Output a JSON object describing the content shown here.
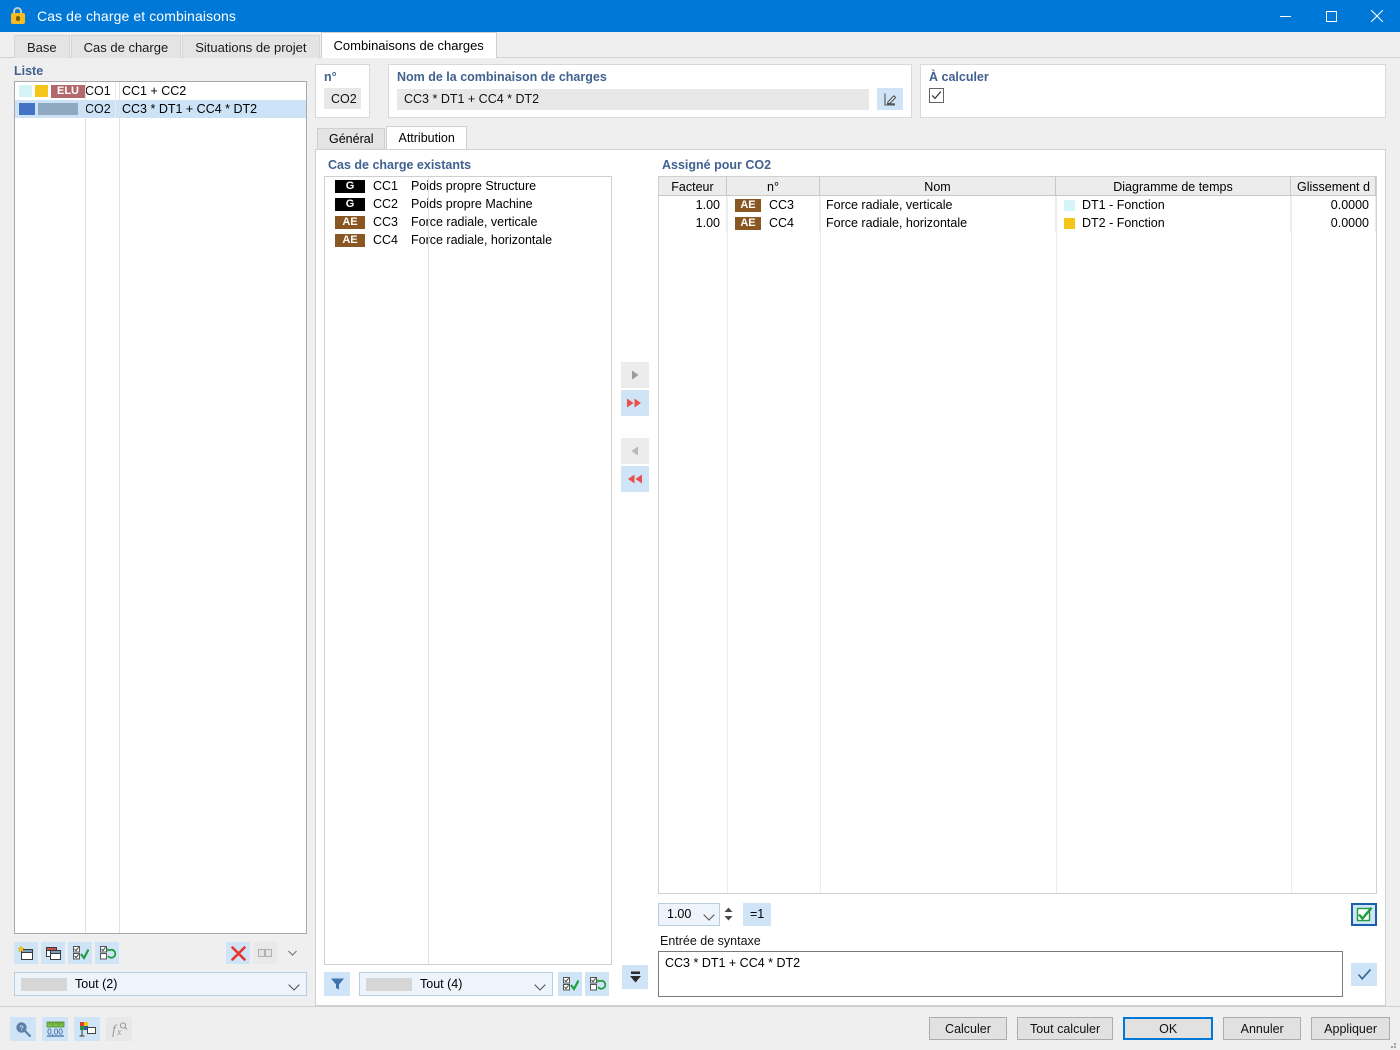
{
  "window": {
    "title": "Cas de charge et combinaisons",
    "icon": "load-case-icon",
    "controls": {
      "minimize": "minimize-icon",
      "maximize": "maximize-icon",
      "close": "close-icon"
    }
  },
  "tabs": [
    {
      "label": "Base",
      "active": false
    },
    {
      "label": "Cas de charge",
      "active": false
    },
    {
      "label": "Situations de projet",
      "active": false
    },
    {
      "label": "Combinaisons de charges",
      "active": true
    }
  ],
  "list_panel": {
    "label": "Liste",
    "rows": [
      {
        "no": "CO1",
        "description": "CC1 + CC2",
        "swatches": [
          "#d4f5f5",
          "#f5c518"
        ],
        "badge": {
          "text": "ELU",
          "color": "#b3696b"
        },
        "selected": false
      },
      {
        "no": "CO2",
        "description": "CC3 * DT1 + CC4 * DT2",
        "swatches": [
          "#4472c4",
          "#8ea9c1"
        ],
        "badge": null,
        "selected": true
      }
    ],
    "toolbar": [
      {
        "name": "new-combination-icon",
        "enabled": true
      },
      {
        "name": "copy-combination-icon",
        "enabled": true
      },
      {
        "name": "check-all-icon",
        "enabled": true
      },
      {
        "name": "invert-check-icon",
        "enabled": true
      },
      {
        "name": "delete-icon",
        "enabled": true
      },
      {
        "name": "columns-icon",
        "enabled": false
      },
      {
        "name": "columns-dropdown-icon",
        "enabled": false
      }
    ],
    "filter_value": "Tout (2)"
  },
  "number_field": {
    "label": "n°",
    "value": "CO2"
  },
  "name_field": {
    "label": "Nom de la combinaison de charges",
    "value": "CC3 * DT1 + CC4 * DT2",
    "edit_icon": "edit-pencil-icon"
  },
  "to_calculate": {
    "label": "À calculer",
    "checked": true
  },
  "inner_tabs": [
    {
      "label": "Général",
      "active": false
    },
    {
      "label": "Attribution",
      "active": true
    }
  ],
  "existing": {
    "label": "Cas de charge existants",
    "rows": [
      {
        "tag": "G",
        "tag_color": "#000000",
        "no": "CC1",
        "name": "Poids propre Structure"
      },
      {
        "tag": "G",
        "tag_color": "#000000",
        "no": "CC2",
        "name": "Poids propre Machine"
      },
      {
        "tag": "AE",
        "tag_color": "#8a5622",
        "no": "CC3",
        "name": "Force radiale, verticale"
      },
      {
        "tag": "AE",
        "tag_color": "#8a5622",
        "no": "CC4",
        "name": "Force radiale, horizontale"
      }
    ],
    "filter": {
      "funnel_icon": "filter-funnel-icon",
      "value": "Tout (4)",
      "check_all_icon": "check-all-icon",
      "invert_check_icon": "invert-check-icon",
      "collapse_icon": "move-down-icon"
    }
  },
  "transfer_buttons": [
    {
      "name": "assign-one-button",
      "glyph": "▶",
      "enabled": false,
      "color": "#9a9a9a"
    },
    {
      "name": "assign-all-button",
      "glyph": "▶▶",
      "enabled": true,
      "color": "#e8504a"
    },
    {
      "name": "remove-one-button",
      "glyph": "◀",
      "enabled": false,
      "color": "#9a9a9a"
    },
    {
      "name": "remove-all-button",
      "glyph": "◀◀",
      "enabled": true,
      "color": "#e8504a"
    }
  ],
  "assigned": {
    "label": "Assigné pour CO2",
    "columns": [
      "Facteur",
      "n°",
      "Nom",
      "Diagramme de temps",
      "Glissement d"
    ],
    "rows": [
      {
        "facteur": "1.00",
        "tag": "AE",
        "tag_color": "#8a5622",
        "no": "CC3",
        "nom": "Force radiale, verticale",
        "diagramme": "DT1 - Fonction",
        "diagramme_color": "#d4f5f5",
        "glissement": "0.0000"
      },
      {
        "facteur": "1.00",
        "tag": "AE",
        "tag_color": "#8a5622",
        "no": "CC4",
        "nom": "Force radiale, horizontale",
        "diagramme": "DT2 - Fonction",
        "diagramme_color": "#f5c518",
        "glissement": "0.0000"
      }
    ],
    "factor_spinner": {
      "value": "1.00"
    },
    "equals_one_button": "=1",
    "confirm_icon": "green-check-box-icon"
  },
  "syntax": {
    "label": "Entrée de syntaxe",
    "value": "CC3 * DT1 + CC4 * DT2",
    "confirm_icon": "check-icon"
  },
  "statusbar_icons": [
    {
      "name": "help-search-icon",
      "enabled": true
    },
    {
      "name": "units-decimal-icon",
      "enabled": true
    },
    {
      "name": "display-properties-icon",
      "enabled": true
    },
    {
      "name": "formula-icon",
      "enabled": false
    }
  ],
  "footer_buttons": [
    {
      "label": "Calculer",
      "primary": false
    },
    {
      "label": "Tout calculer",
      "primary": false
    },
    {
      "label": "OK",
      "primary": true
    },
    {
      "label": "Annuler",
      "primary": false
    },
    {
      "label": "Appliquer",
      "primary": false
    }
  ],
  "colors": {
    "accent": "#0078d7",
    "label_blue": "#41618f",
    "highlight": "#cce3f7",
    "tool_bg": "#cfe5f7"
  }
}
